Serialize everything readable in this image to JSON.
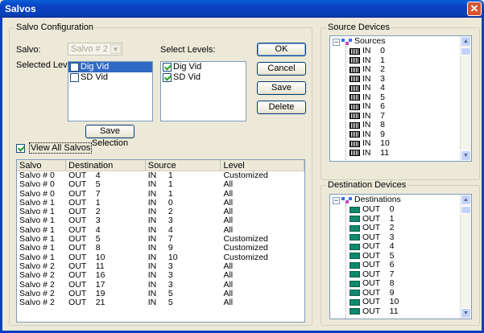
{
  "window": {
    "title": "Salvos",
    "close_label": "✕"
  },
  "config": {
    "group_label": "Salvo Configuration",
    "salvo_label": "Salvo:",
    "salvo_value": "Salvo # 2",
    "selected_levels_label": "Selected Levels:",
    "selected_levels": [
      {
        "label": "Dig Vid",
        "checked": false,
        "selected": true
      },
      {
        "label": "SD Vid",
        "checked": false,
        "selected": false
      }
    ],
    "select_levels_label": "Select Levels:",
    "select_levels": [
      {
        "label": "Dig Vid",
        "checked": true
      },
      {
        "label": "SD Vid",
        "checked": true
      }
    ],
    "save_selection_label": "Save Selection",
    "view_all_label": "View All Salvos",
    "view_all_checked": true
  },
  "buttons": {
    "ok": "OK",
    "cancel": "Cancel",
    "save": "Save",
    "delete": "Delete"
  },
  "table": {
    "headers": [
      "Salvo",
      "Destination",
      "Source",
      "Level"
    ],
    "rows": [
      [
        "Salvo # 0",
        "OUT    4",
        "IN     1",
        "Customized"
      ],
      [
        "Salvo # 0",
        "OUT    5",
        "IN     1",
        "All"
      ],
      [
        "Salvo # 0",
        "OUT    7",
        "IN     1",
        "All"
      ],
      [
        "Salvo # 1",
        "OUT    1",
        "IN     0",
        "All"
      ],
      [
        "Salvo # 1",
        "OUT    2",
        "IN     2",
        "All"
      ],
      [
        "Salvo # 1",
        "OUT    3",
        "IN     3",
        "All"
      ],
      [
        "Salvo # 1",
        "OUT    4",
        "IN     4",
        "All"
      ],
      [
        "Salvo # 1",
        "OUT    5",
        "IN     7",
        "Customized"
      ],
      [
        "Salvo # 1",
        "OUT    8",
        "IN     9",
        "Customized"
      ],
      [
        "Salvo # 1",
        "OUT    10",
        "IN     10",
        "Customized"
      ],
      [
        "Salvo # 2",
        "OUT    11",
        "IN     3",
        "All"
      ],
      [
        "Salvo # 2",
        "OUT    16",
        "IN     3",
        "All"
      ],
      [
        "Salvo # 2",
        "OUT    17",
        "IN     3",
        "All"
      ],
      [
        "Salvo # 2",
        "OUT    19",
        "IN     5",
        "All"
      ],
      [
        "Salvo # 2",
        "OUT    21",
        "IN     5",
        "All"
      ]
    ]
  },
  "source_devices": {
    "group_label": "Source Devices",
    "root": "Sources",
    "items": [
      "IN    0",
      "IN    1",
      "IN    2",
      "IN    3",
      "IN    4",
      "IN    5",
      "IN    6",
      "IN    7",
      "IN    8",
      "IN    9",
      "IN    10",
      "IN    11"
    ]
  },
  "destination_devices": {
    "group_label": "Destination Devices",
    "root": "Destinations",
    "items": [
      "OUT    0",
      "OUT    1",
      "OUT    2",
      "OUT    3",
      "OUT    4",
      "OUT    5",
      "OUT    6",
      "OUT    7",
      "OUT    8",
      "OUT    9",
      "OUT    10",
      "OUT    11"
    ]
  },
  "colors": {
    "titlebar": "#0a3fc0",
    "selection": "#316ac5",
    "dest_icon": "#0f8a6d"
  }
}
